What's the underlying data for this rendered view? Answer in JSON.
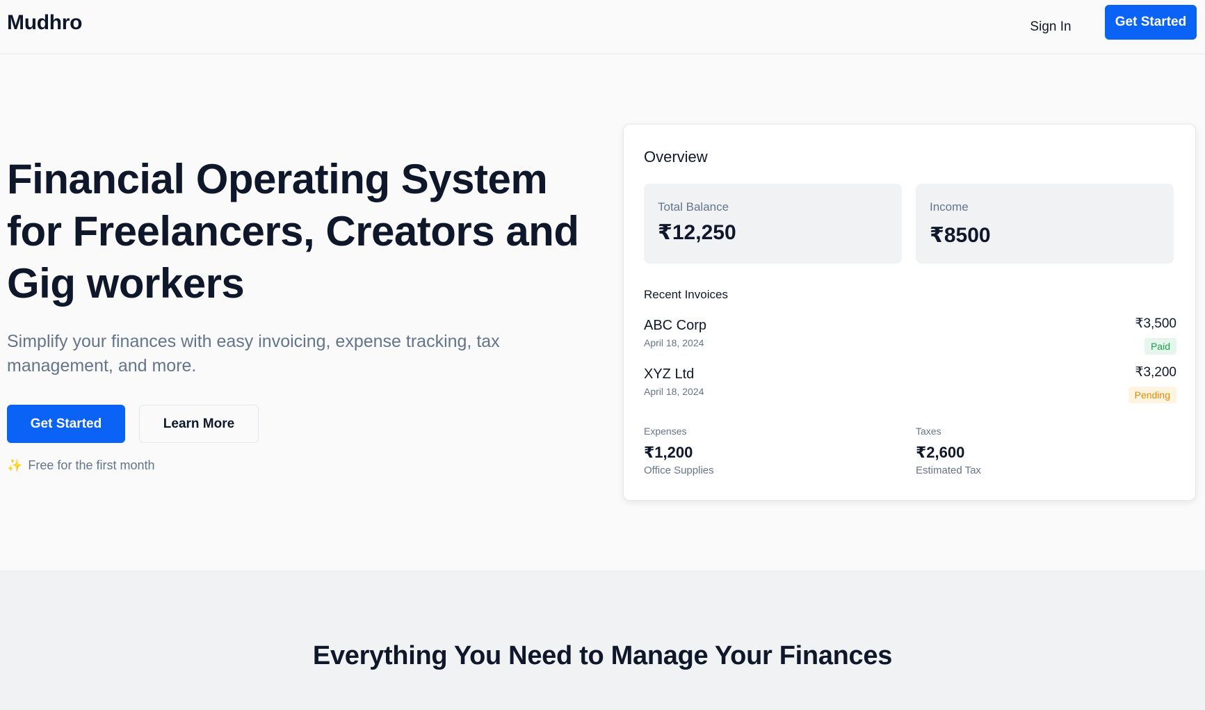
{
  "nav": {
    "brand": "Mudhro",
    "sign_in": "Sign In",
    "get_started": "Get Started"
  },
  "hero": {
    "title": "Financial Operating System for Freelancers, Creators and Gig workers",
    "subtitle": "Simplify your finances with easy invoicing, expense tracking, tax management, and more.",
    "primary_cta": "Get Started",
    "secondary_cta": "Learn More",
    "promo_icon": "sparkles-icon",
    "promo_text": "Free for the first month"
  },
  "overview": {
    "title": "Overview",
    "total_balance": {
      "label": "Total Balance",
      "value": "₹12,250"
    },
    "income": {
      "label": "Income",
      "value": "₹8500"
    },
    "recent_invoices_label": "Recent Invoices",
    "invoices": [
      {
        "client": "ABC Corp",
        "date": "April 18, 2024",
        "amount": "₹3,500",
        "status": "Paid"
      },
      {
        "client": "XYZ Ltd",
        "date": "April 18, 2024",
        "amount": "₹3,200",
        "status": "Pending"
      }
    ],
    "expenses": {
      "label": "Expenses",
      "value": "₹1,200",
      "sub": "Office Supplies"
    },
    "taxes": {
      "label": "Taxes",
      "value": "₹2,600",
      "sub": "Estimated Tax"
    }
  },
  "features": {
    "title": "Everything You Need to Manage Your Finances"
  },
  "colors": {
    "accent": "#0b63f6",
    "paid": "#16a34a",
    "pending": "#e58a00"
  }
}
